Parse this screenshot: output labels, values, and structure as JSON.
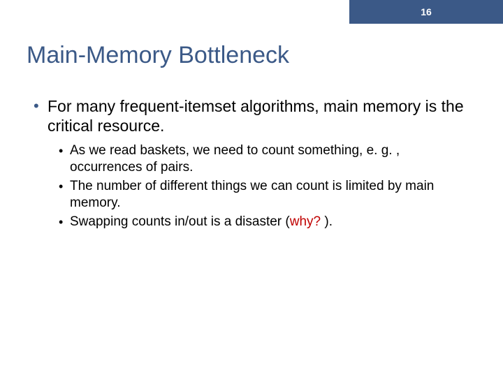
{
  "page_number": "16",
  "title": "Main-Memory Bottleneck",
  "bullets": {
    "main": "For many frequent-itemset algorithms, main memory is the critical resource.",
    "subs": [
      "As we read baskets, we need to count something, e. g. , occurrences of pairs.",
      "The number of different things we can count is limited by main memory.",
      "Swapping counts in/out is a disaster ("
    ],
    "why": "why? ",
    "tail": ")."
  }
}
